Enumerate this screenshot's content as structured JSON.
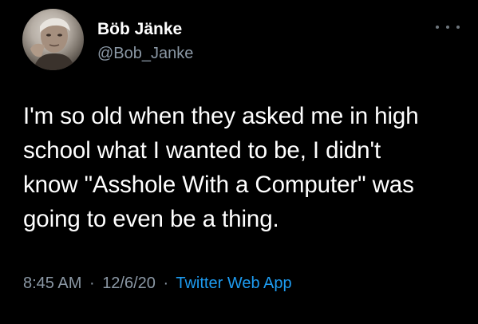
{
  "user": {
    "display_name": "Böb Jänke",
    "handle": "@Bob_Janke",
    "avatar_icon": "avatar-photo"
  },
  "menu": {
    "icon": "more-icon"
  },
  "tweet": {
    "lines": [
      "I'm so old when they asked me in high",
      "school what I wanted to be, I didn't",
      "know \"Asshole With a Computer\" was",
      "going to even be a thing."
    ],
    "time": "8:45 AM",
    "date": "12/6/20",
    "source": "Twitter Web App",
    "separator": "·"
  },
  "colors": {
    "background": "#000000",
    "text": "#ffffff",
    "secondary": "#8b98a5",
    "link": "#1d9bf0"
  }
}
